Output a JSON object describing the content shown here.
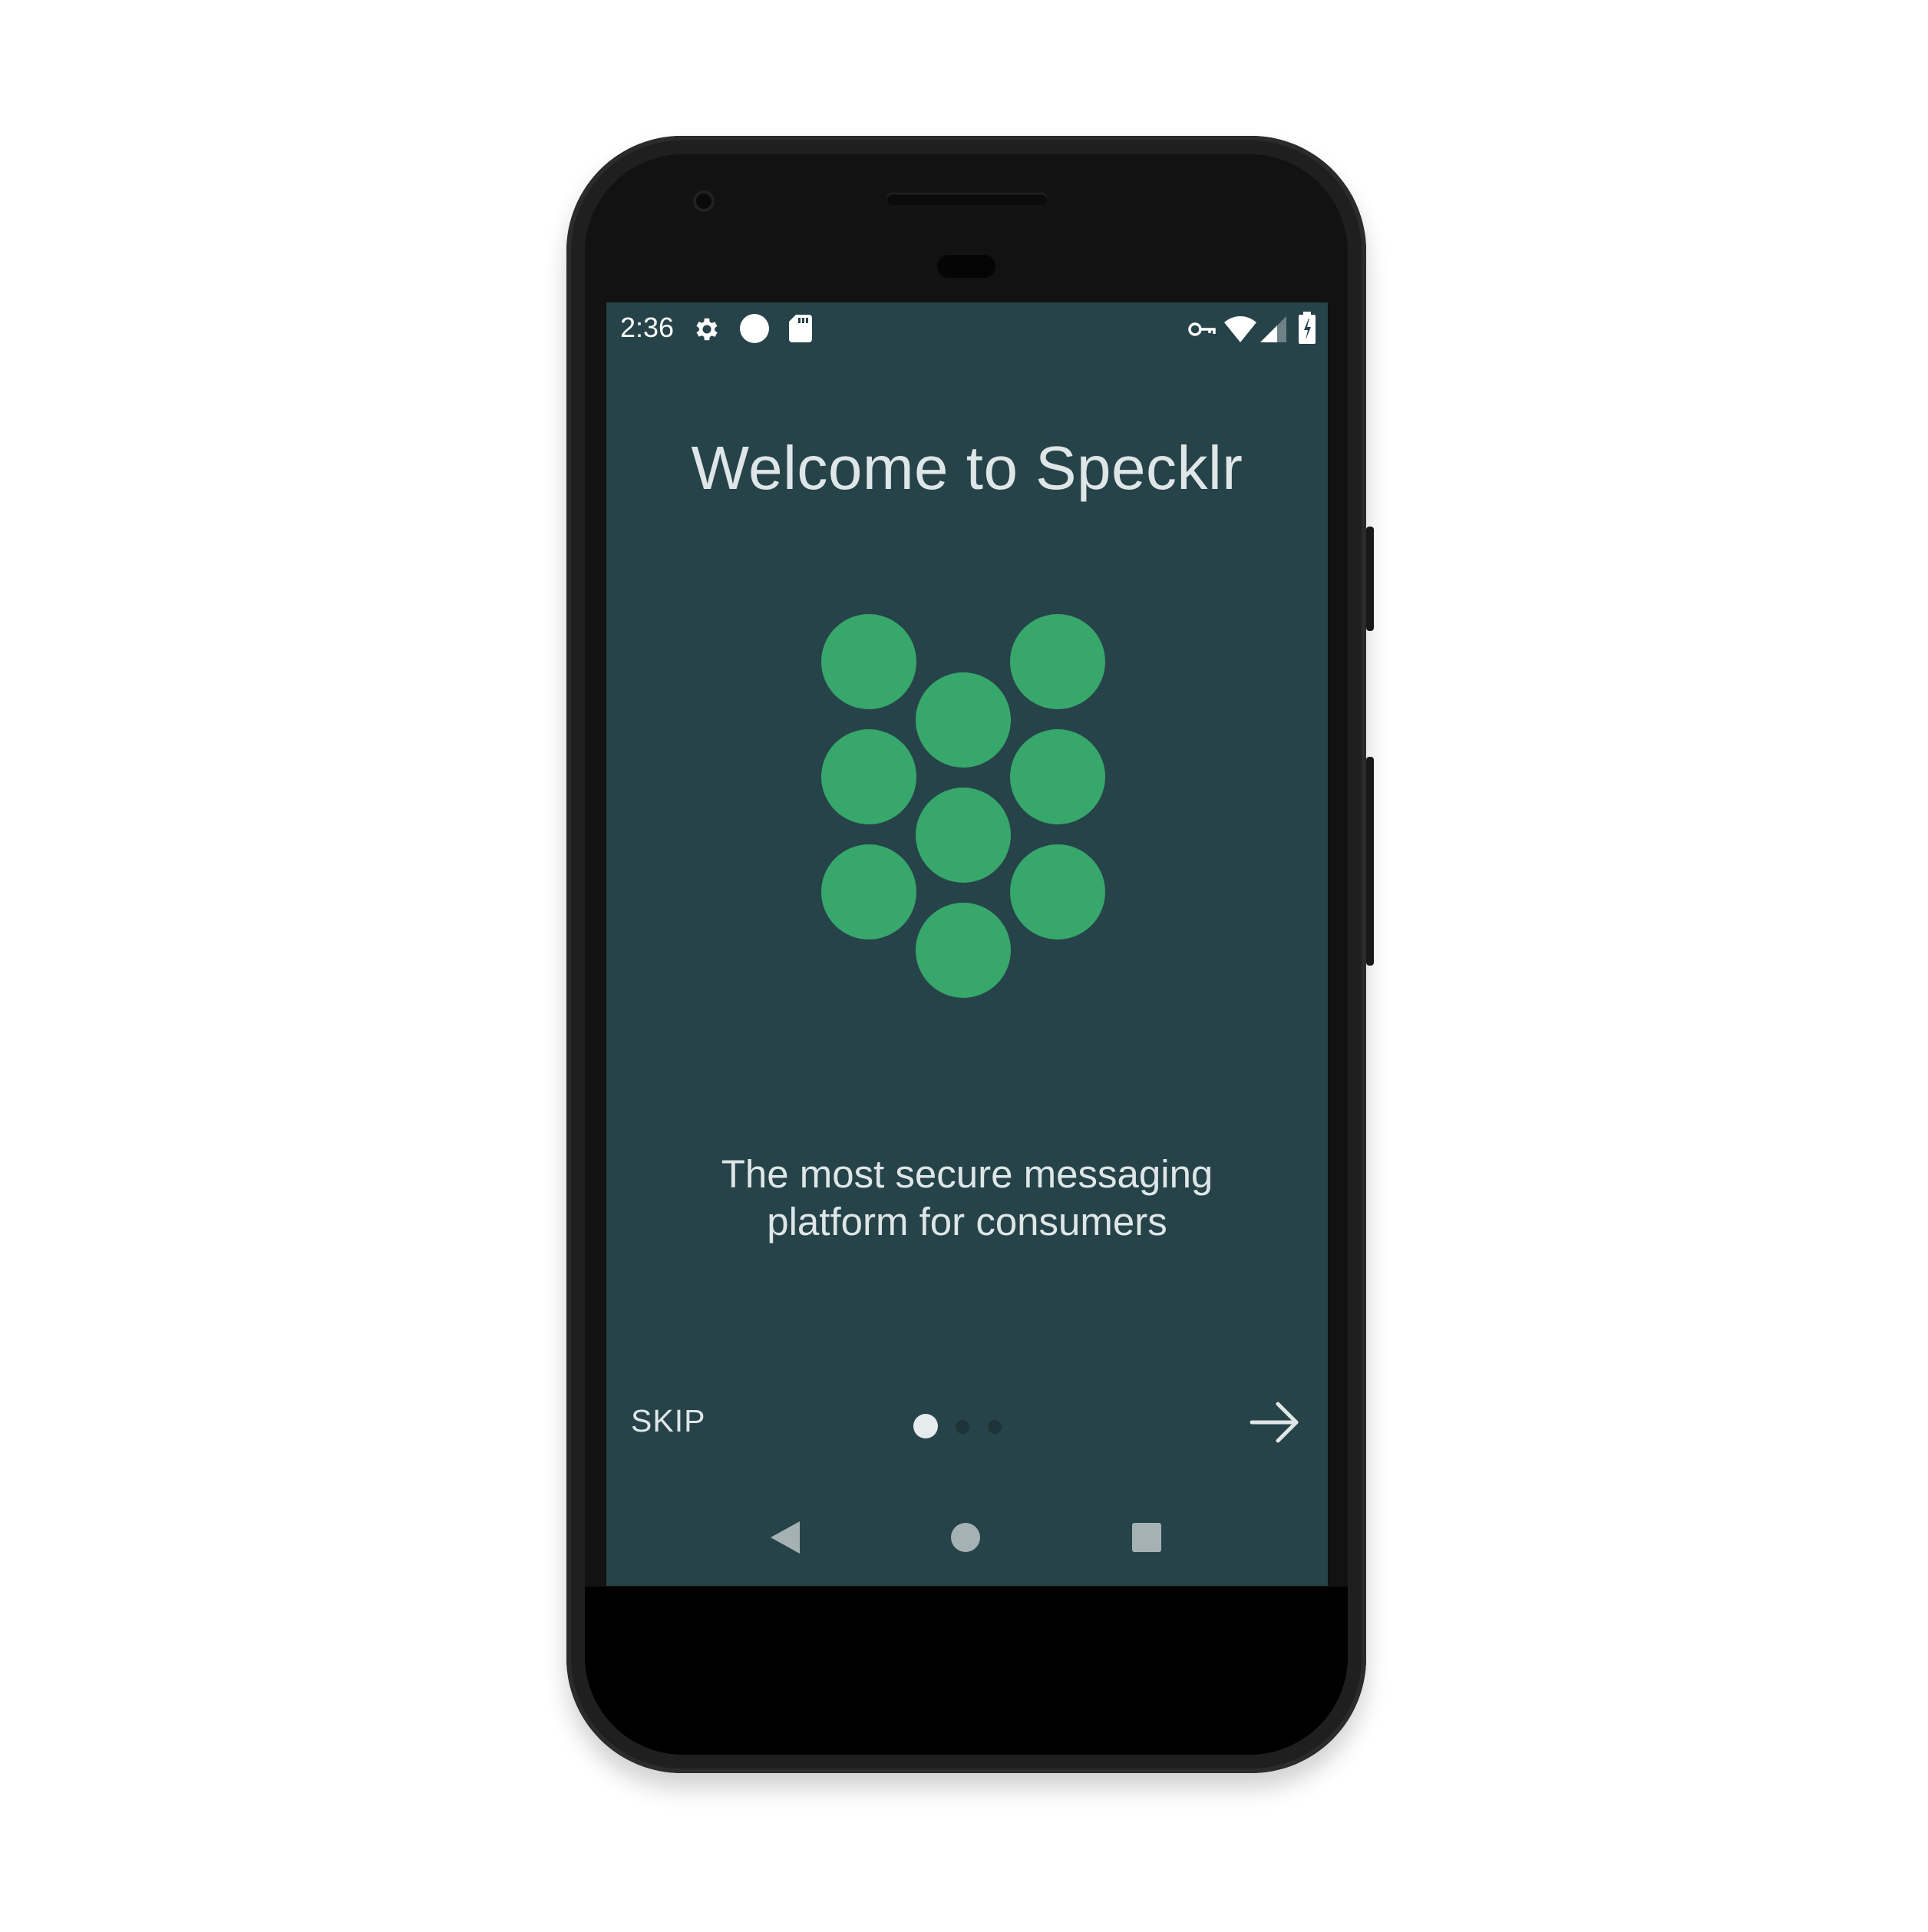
{
  "status_bar": {
    "time": "2:36",
    "left_icons": [
      "settings-gear-icon",
      "circle-notification-icon",
      "sd-card-icon"
    ],
    "right_icons": [
      "vpn-key-icon",
      "wifi-icon",
      "cell-signal-icon",
      "battery-charging-icon"
    ]
  },
  "onboarding": {
    "title": "Welcome to Specklr",
    "tagline_line1": "The most secure messaging",
    "tagline_line2": "platform for consumers",
    "skip_label": "SKIP",
    "page_indicator": {
      "current": 1,
      "total": 3
    },
    "next_icon": "arrow-forward-icon"
  },
  "navigation_bar": {
    "icons": [
      "back-icon",
      "home-icon",
      "recents-icon"
    ]
  },
  "colors": {
    "screen_background": "#264349",
    "logo_green": "#37a76b",
    "text_light": "#dfe6e7",
    "dot_active": "#e6eced",
    "dot_inactive": "#1d3439",
    "nav_icon": "#a5b2b4"
  }
}
